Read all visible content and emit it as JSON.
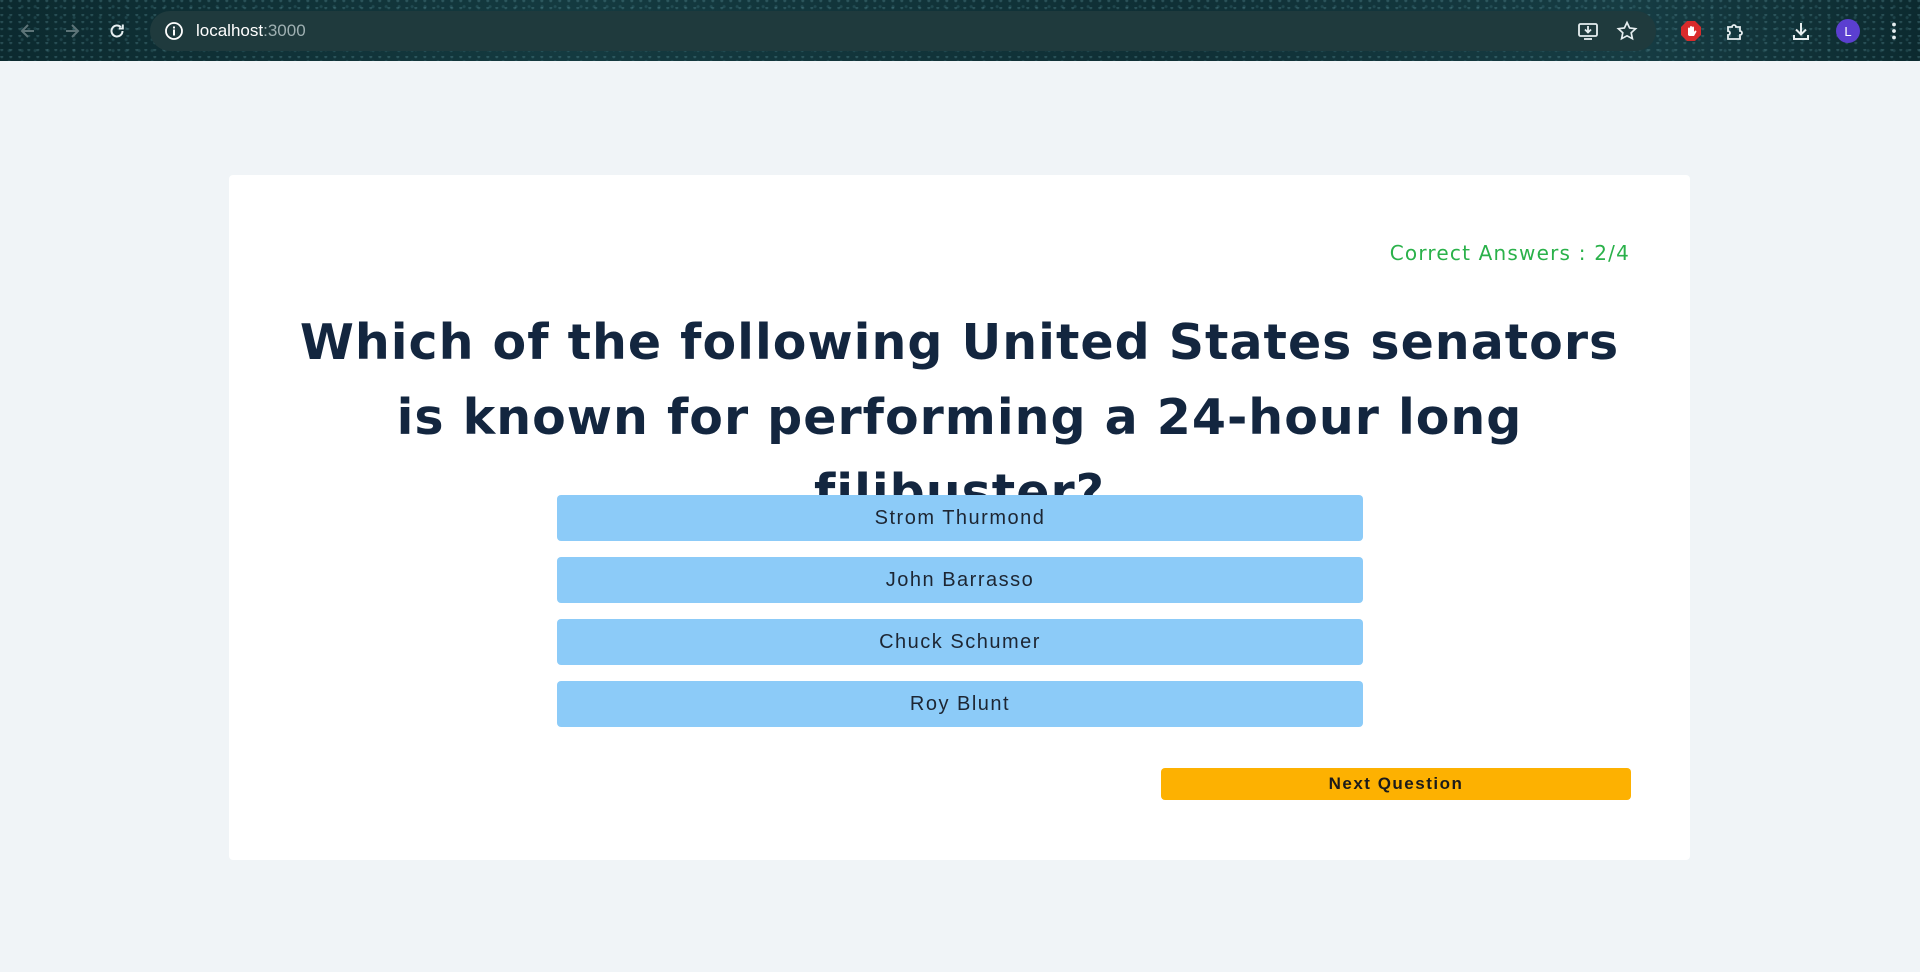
{
  "browser": {
    "url_host": "localhost",
    "url_port": ":3000",
    "profile_initial": "L",
    "icons": [
      "back-arrow-icon",
      "forward-arrow-icon",
      "reload-icon",
      "site-info-icon",
      "install-app-icon",
      "bookmark-star-icon",
      "extension-stop-icon",
      "extensions-puzzle-icon",
      "download-icon",
      "menu-kebab-icon"
    ]
  },
  "quiz": {
    "score_label": "Correct Answers : 2/4",
    "question": "Which of the following United States senators is known for performing a 24-hour long filibuster?",
    "answers": [
      "Strom Thurmond",
      "John Barrasso",
      "Chuck Schumer",
      "Roy Blunt"
    ],
    "next_label": "Next Question"
  },
  "colors": {
    "page_bg": "#f0f4f7",
    "card_bg": "#ffffff",
    "score_text": "#2ab14a",
    "question_text": "#13263f",
    "answer_bg": "#8ccbf8",
    "next_bg": "#fdb101",
    "avatar_bg": "#5b3fd0"
  }
}
